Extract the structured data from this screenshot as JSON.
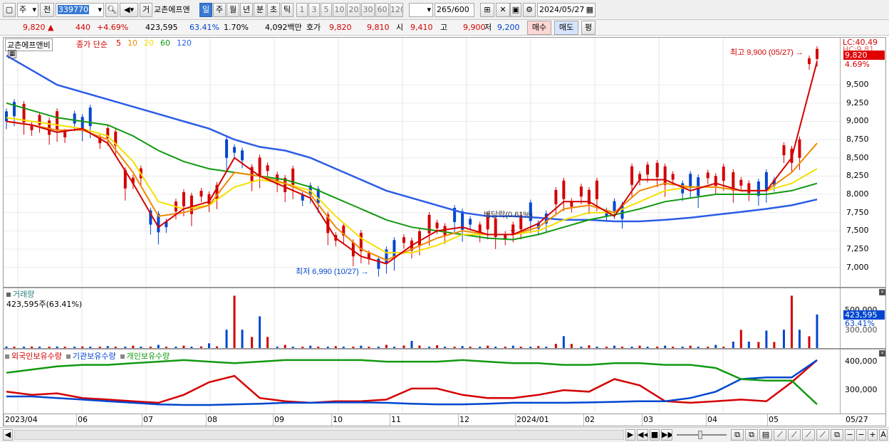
{
  "toolbar": {
    "market": "주",
    "prev": "전",
    "code": "339770",
    "type_btn": "거",
    "name": "교촌에프앤",
    "periods": [
      "일",
      "주",
      "월",
      "년",
      "분",
      "초",
      "틱"
    ],
    "active_period": "일",
    "intervals": [
      "1",
      "3",
      "5",
      "10",
      "20",
      "30",
      "60",
      "120"
    ],
    "count": "265",
    "count_max": "/600",
    "date": "2024/05/27"
  },
  "quote": {
    "price": "9,820",
    "change": "440",
    "change_pct": "+4.69%",
    "volume": "423,595",
    "vol_ratio": "63.41%",
    "turnover": "1.70%",
    "amount": "4,092백만",
    "bid_label": "호가",
    "ask": "9,820",
    "bid": "9,810",
    "open_label": "시",
    "open": "9,410",
    "high_label": "고",
    "high": "9,900",
    "low_label": "저",
    "low": "9,200",
    "buy": "매수",
    "sell": "매도",
    "flat": "평"
  },
  "price_panel": {
    "name": "교촌에프앤비",
    "indicator": "종가 단순",
    "ma_periods": [
      "5",
      "10",
      "20",
      "60",
      "120"
    ],
    "lc": "LC:40.49",
    "hc": "HC:9.81",
    "last": "9,820",
    "last_pct": "4.69%",
    "high_note": "최고 9,900 (05/27)",
    "low_note": "최저 6,990 (10/27)",
    "dividend_note": "배당락(0.61%)",
    "yticks": [
      "9,500",
      "9,250",
      "9,000",
      "8,750",
      "8,500",
      "8,250",
      "8,000",
      "7,750",
      "7,500",
      "7,250",
      "7,000"
    ]
  },
  "volume_panel": {
    "title": "거래량",
    "value": "423,595주(63.41%)",
    "yticks": [
      "500,000",
      "300,000"
    ],
    "last": "423,595",
    "last_pct": "63.41%"
  },
  "holding_panel": {
    "series": [
      "외국인보유수량",
      "기관보유수량",
      "개인보유수량"
    ],
    "yticks": [
      "400,000",
      "300,000"
    ]
  },
  "xaxis": {
    "labels": [
      "2023/04",
      "06",
      "07",
      "08",
      "09",
      "10",
      "11",
      "12",
      "2024/01",
      "02",
      "03",
      "04",
      "05"
    ],
    "right": "05/27"
  },
  "colors": {
    "up": "#d40000",
    "down": "#0046d0",
    "ma5": "#d40000",
    "ma10": "#f08a00",
    "ma20": "#f5e000",
    "ma60": "#119911",
    "ma120": "#2b5ce6"
  },
  "chart_data": [
    {
      "type": "line",
      "title": "교촌에프앤비 종가 단순",
      "series": [
        {
          "name": "5",
          "values": [
            9000,
            8950,
            8850,
            8900,
            8700,
            8150,
            7550,
            7800,
            7900,
            8500,
            8250,
            8100,
            7950,
            7400,
            7150,
            7050,
            7300,
            7500,
            7550,
            7450,
            7450,
            7600,
            7900,
            7900,
            7700,
            8200,
            8200,
            8050,
            8150,
            8050,
            8050,
            8500,
            9820
          ]
        },
        {
          "name": "10",
          "values": [
            9000,
            8950,
            8880,
            8880,
            8750,
            8300,
            7700,
            7750,
            7850,
            8300,
            8250,
            8150,
            8000,
            7550,
            7250,
            7100,
            7250,
            7400,
            7500,
            7450,
            7450,
            7550,
            7800,
            7850,
            7750,
            8050,
            8150,
            8100,
            8100,
            8050,
            8050,
            8300,
            8700
          ]
        },
        {
          "name": "20",
          "values": [
            9050,
            9000,
            8950,
            8900,
            8800,
            8450,
            7900,
            7800,
            7850,
            8100,
            8200,
            8150,
            8050,
            7700,
            7400,
            7200,
            7200,
            7300,
            7450,
            7450,
            7450,
            7500,
            7650,
            7750,
            7750,
            7900,
            8050,
            8100,
            8100,
            8050,
            8050,
            8150,
            8350
          ]
        },
        {
          "name": "60",
          "values": [
            9250,
            9150,
            9050,
            9000,
            8950,
            8800,
            8600,
            8450,
            8350,
            8300,
            8250,
            8200,
            8100,
            7950,
            7800,
            7650,
            7550,
            7500,
            7450,
            7400,
            7380,
            7450,
            7550,
            7650,
            7720,
            7800,
            7900,
            7950,
            8000,
            8000,
            8000,
            8050,
            8150
          ]
        },
        {
          "name": "120",
          "values": [
            9900,
            9700,
            9500,
            9400,
            9300,
            9200,
            9100,
            9000,
            8900,
            8750,
            8650,
            8600,
            8500,
            8350,
            8200,
            8050,
            7950,
            7850,
            7750,
            7700,
            7700,
            7680,
            7650,
            7650,
            7630,
            7630,
            7650,
            7680,
            7720,
            7760,
            7800,
            7850,
            7930
          ]
        }
      ]
    },
    {
      "type": "bar",
      "title": "거래량",
      "series": [
        {
          "name": "거래량",
          "values": [
            20000,
            20000,
            20000,
            20000,
            25000,
            30000,
            40000,
            30000,
            60000,
            660000,
            400000,
            40000,
            30000,
            25000,
            30000,
            40000,
            90000,
            35000,
            25000,
            30000,
            30000,
            25000,
            150000,
            35000,
            30000,
            30000,
            30000,
            30000,
            40000,
            230000,
            220000,
            660000,
            423595
          ]
        }
      ]
    },
    {
      "type": "line",
      "title": "보유수량",
      "series": [
        {
          "name": "외국인보유수량",
          "values": [
            300000,
            290000,
            295000,
            280000,
            275000,
            270000,
            265000,
            290000,
            330000,
            350000,
            280000,
            270000,
            265000,
            270000,
            270000,
            275000,
            310000,
            310000,
            290000,
            280000,
            280000,
            290000,
            305000,
            300000,
            340000,
            320000,
            270000,
            265000,
            270000,
            275000,
            270000,
            330000,
            400000
          ]
        },
        {
          "name": "기관보유수량",
          "values": [
            285000,
            285000,
            280000,
            275000,
            270000,
            265000,
            260000,
            258000,
            258000,
            260000,
            262000,
            265000,
            265000,
            266000,
            266000,
            265000,
            262000,
            260000,
            260000,
            262000,
            265000,
            265000,
            265000,
            266000,
            268000,
            270000,
            270000,
            280000,
            300000,
            340000,
            345000,
            345000,
            400000
          ]
        },
        {
          "name": "개인보유수량",
          "values": [
            360000,
            370000,
            380000,
            385000,
            385000,
            390000,
            395000,
            400000,
            395000,
            390000,
            395000,
            400000,
            400000,
            400000,
            400000,
            395000,
            395000,
            395000,
            400000,
            395000,
            390000,
            390000,
            385000,
            385000,
            390000,
            390000,
            385000,
            385000,
            375000,
            340000,
            335000,
            335000,
            260000
          ]
        }
      ]
    }
  ]
}
